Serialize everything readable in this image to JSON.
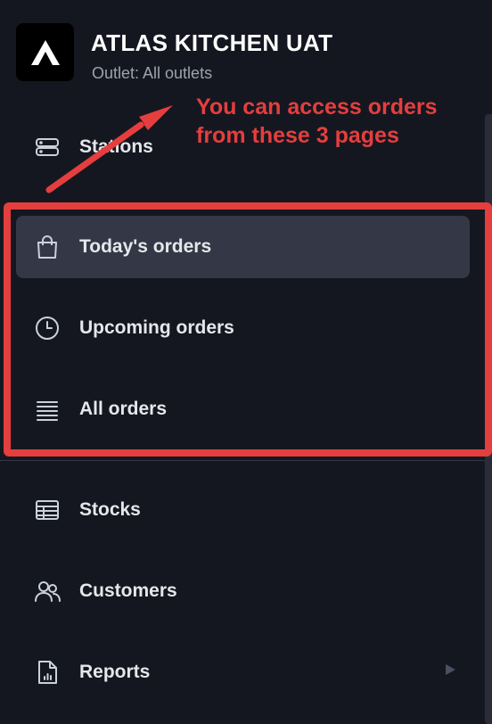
{
  "header": {
    "title": "ATLAS KITCHEN UAT",
    "subtitle": "Outlet: All outlets"
  },
  "nav": {
    "stations": {
      "label": "Stations",
      "icon": "server-stack-icon"
    },
    "todays_orders": {
      "label": "Today's orders",
      "icon": "shopping-bag-icon",
      "active": true
    },
    "upcoming_orders": {
      "label": "Upcoming orders",
      "icon": "clock-icon"
    },
    "all_orders": {
      "label": "All orders",
      "icon": "list-lines-icon"
    },
    "stocks": {
      "label": "Stocks",
      "icon": "table-icon"
    },
    "customers": {
      "label": "Customers",
      "icon": "users-icon"
    },
    "reports": {
      "label": "Reports",
      "icon": "document-chart-icon"
    }
  },
  "annotation": {
    "text_line1": "You can access orders",
    "text_line2": "from these 3 pages",
    "color": "#e53e3e"
  },
  "colors": {
    "background": "#151720",
    "active_item": "#343745",
    "text": "#e5e7eb",
    "muted_text": "#9ca3af"
  }
}
